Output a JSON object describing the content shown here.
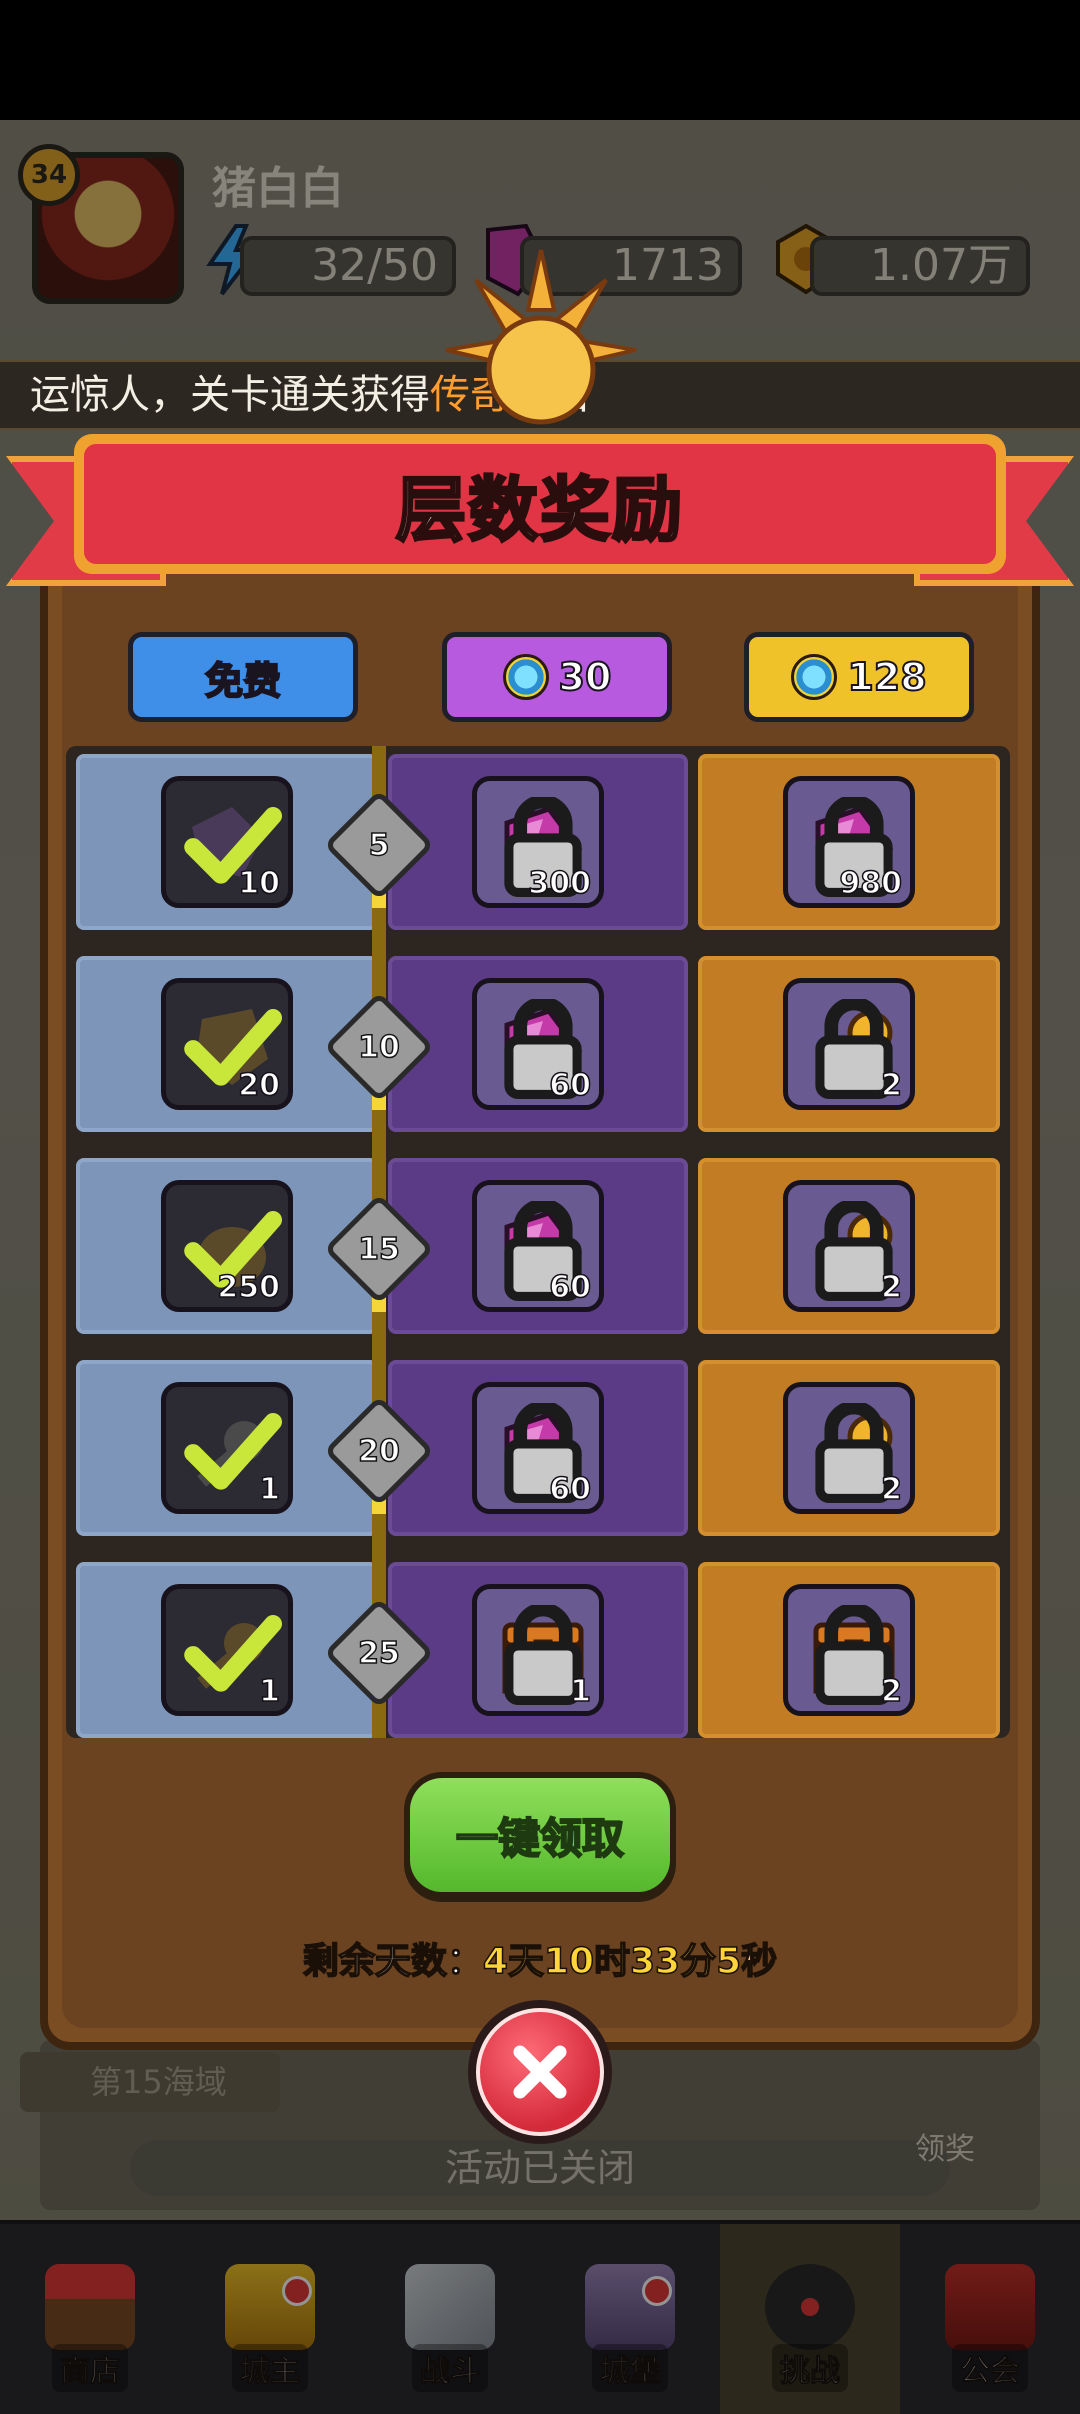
{
  "player": {
    "name": "猪白白",
    "level": "34"
  },
  "resources": {
    "energy": "32/50",
    "gems": "1713",
    "coins": "1.07万"
  },
  "marquee": {
    "text_before": "运惊人，关卡通关获得",
    "highlight": "传奇",
    "text_after": "宝石"
  },
  "background": {
    "level_tag": "第15海域",
    "event_status": "活动已关闭",
    "claim_label": "领奖"
  },
  "modal": {
    "title": "层数奖励",
    "tiers": [
      {
        "label": "免费"
      },
      {
        "label": "30"
      },
      {
        "label": "128"
      }
    ],
    "rows": [
      {
        "floor": "5",
        "free": {
          "icon": "gem-shard-icon",
          "count": "10",
          "claimed": true
        },
        "purple": {
          "icon": "gem-icon",
          "count": "300",
          "locked": true
        },
        "gold": {
          "icon": "gem-icon",
          "count": "980",
          "locked": true
        }
      },
      {
        "floor": "10",
        "free": {
          "icon": "key-shard-icon",
          "count": "20",
          "claimed": true
        },
        "purple": {
          "icon": "gem-icon",
          "count": "60",
          "locked": true
        },
        "gold": {
          "icon": "key-icon",
          "count": "2",
          "locked": true
        }
      },
      {
        "floor": "15",
        "free": {
          "icon": "coin-bag-icon",
          "count": "250",
          "claimed": true
        },
        "purple": {
          "icon": "gem-icon",
          "count": "60",
          "locked": true
        },
        "gold": {
          "icon": "key-icon",
          "count": "2",
          "locked": true
        }
      },
      {
        "floor": "20",
        "free": {
          "icon": "key-silver-icon",
          "count": "1",
          "claimed": true
        },
        "purple": {
          "icon": "gem-icon",
          "count": "60",
          "locked": true
        },
        "gold": {
          "icon": "key-icon",
          "count": "2",
          "locked": true
        }
      },
      {
        "floor": "25",
        "free": {
          "icon": "key-gold-icon",
          "count": "1",
          "claimed": true
        },
        "purple": {
          "icon": "chest-icon",
          "count": "1",
          "locked": true
        },
        "gold": {
          "icon": "chest-icon",
          "count": "2",
          "locked": true
        }
      }
    ],
    "claim_all_label": "一键领取",
    "countdown_label": "剩余天数：",
    "countdown_value": "4天10时33分5秒"
  },
  "nav": [
    {
      "label": "商店",
      "icon": "shop-icon"
    },
    {
      "label": "城主",
      "icon": "crown-icon"
    },
    {
      "label": "战斗",
      "icon": "swords-icon"
    },
    {
      "label": "城堡",
      "icon": "castle-icon"
    },
    {
      "label": "挑战",
      "icon": "demon-icon",
      "active": true
    },
    {
      "label": "公会",
      "icon": "guild-banner-icon"
    }
  ],
  "colors": {
    "ribbon": "#e13545",
    "free_tier": "#3f8fe8",
    "purple_tier": "#b75ae0",
    "gold_tier": "#f0c22a",
    "claim_green": "#6cc93c",
    "countdown_yellow": "#ffd53a"
  }
}
